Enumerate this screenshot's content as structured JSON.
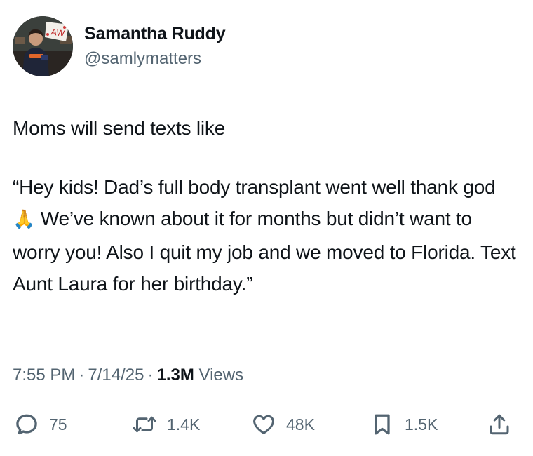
{
  "author": {
    "name": "Samantha Ruddy",
    "handle": "@samlymatters",
    "avatar_sign_text": "AW"
  },
  "tweet": {
    "line_1": "Moms will send texts like",
    "quote_part_1": "“Hey kids! Dad’s full body transplant went well thank god ",
    "emoji": "🙏",
    "quote_part_2": " We’ve known about it for months but didn’t want to worry you! Also I quit my job and we moved to Florida. Text Aunt Laura for her birthday.”"
  },
  "meta": {
    "time": "7:55 PM",
    "separator": "·",
    "date": "7/14/25",
    "views_count": "1.3M",
    "views_label": "Views"
  },
  "actions": {
    "replies": "75",
    "reposts": "1.4K",
    "likes": "48K",
    "bookmarks": "1.5K"
  },
  "colors": {
    "text_primary": "#0f1419",
    "text_secondary": "#536471",
    "background": "#ffffff"
  },
  "icons": [
    "reply-icon",
    "repost-icon",
    "like-icon",
    "bookmark-icon",
    "share-icon"
  ]
}
